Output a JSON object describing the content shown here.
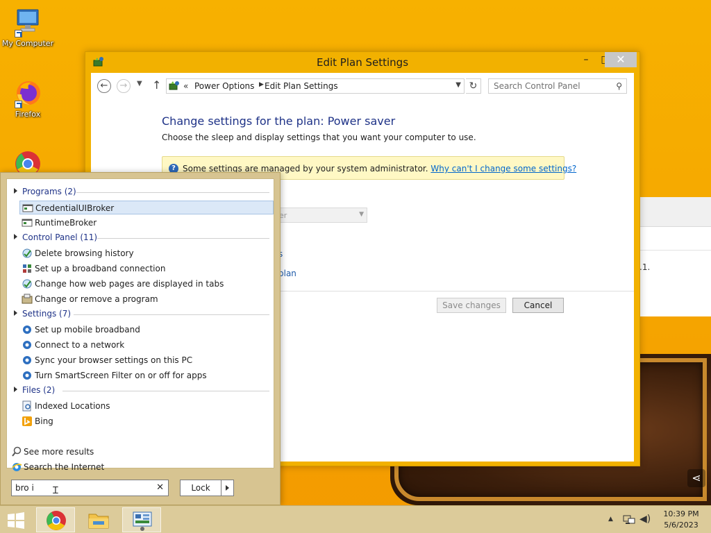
{
  "desktop": {
    "icons": [
      {
        "label": "My Computer",
        "icon": "computer-icon"
      },
      {
        "label": "Firefox",
        "icon": "firefox-icon"
      },
      {
        "label": "",
        "icon": "chrome-icon"
      }
    ]
  },
  "window": {
    "title": "Edit Plan Settings",
    "controls": {
      "minimize": "–",
      "maximize": "□",
      "close": "✕"
    },
    "toolbar": {
      "back": "←",
      "forward": "→",
      "up": "↑",
      "breadcrumb_root_glyph": "«",
      "breadcrumbs": [
        "Power Options",
        "Edit Plan Settings"
      ],
      "search_placeholder": "Search Control Panel"
    },
    "content": {
      "heading": "Change settings for the plan: Power saver",
      "subheading": "Choose the sleep and display settings that you want your computer to use.",
      "notice_text": "Some settings are managed by your system administrator.",
      "notice_link": "Why can't I change some settings?",
      "partial_select_value": "er",
      "partial_link_1": "s",
      "partial_link_2": "plan",
      "save_button": "Save changes",
      "cancel_button": "Cancel"
    }
  },
  "background_window": {
    "partial_text": ".1."
  },
  "search_panel": {
    "groups": [
      {
        "header": "Programs (2)",
        "items": [
          {
            "label": "CredentialUIBroker",
            "icon": "app-window-icon",
            "selected": true
          },
          {
            "label": "RuntimeBroker",
            "icon": "app-window-icon",
            "selected": false
          }
        ]
      },
      {
        "header": "Control Panel (11)",
        "items": [
          {
            "label": "Delete browsing history",
            "icon": "internet-options-icon"
          },
          {
            "label": "Set up a broadband connection",
            "icon": "network-center-icon"
          },
          {
            "label": "Change how web pages are displayed in tabs",
            "icon": "internet-options-icon"
          },
          {
            "label": "Change or remove a program",
            "icon": "programs-features-icon"
          }
        ]
      },
      {
        "header": "Settings (7)",
        "items": [
          {
            "label": "Set up mobile broadband",
            "icon": "gear-icon"
          },
          {
            "label": "Connect to a network",
            "icon": "gear-icon"
          },
          {
            "label": "Sync your browser settings on this PC",
            "icon": "gear-icon"
          },
          {
            "label": "Turn SmartScreen Filter on or off for apps",
            "icon": "gear-icon"
          }
        ]
      },
      {
        "header": "Files (2)",
        "items": [
          {
            "label": "Indexed Locations",
            "icon": "indexed-locations-icon"
          },
          {
            "label": "Bing",
            "icon": "bing-icon"
          }
        ]
      }
    ],
    "footer": [
      {
        "label": "See more results",
        "icon": "magnifier-icon"
      },
      {
        "label": "Search the Internet",
        "icon": "ie-icon"
      }
    ],
    "query": "bro i",
    "clear_glyph": "✕",
    "lock_label": "Lock"
  },
  "taskbar": {
    "items": [
      "start-button",
      "chrome-icon",
      "file-explorer-icon",
      "control-panel-icon"
    ],
    "clock_time": "10:39 PM",
    "clock_date": "5/6/2023"
  },
  "colors": {
    "desktop": "#f6a800",
    "accent_blue": "#1e3287",
    "link_blue": "#0066cc",
    "taskbar": "#dccb9a",
    "selection": "#dbe8f7"
  }
}
